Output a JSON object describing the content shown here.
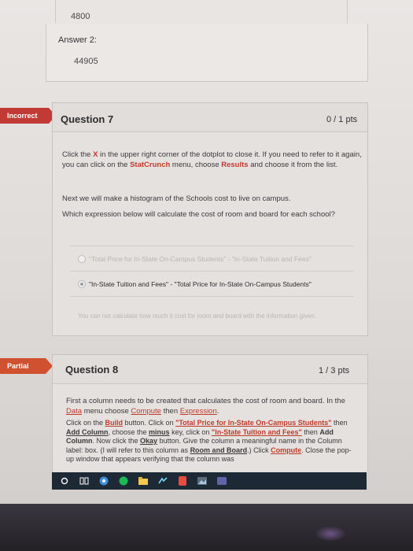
{
  "previous_question": {
    "top_value": "4800",
    "answer_label": "Answer 2:",
    "answer_value": "44905"
  },
  "question7": {
    "flag": "Incorrect",
    "title": "Question 7",
    "points": "0 / 1 pts",
    "instruction": {
      "p1": "Click the ",
      "x": "X",
      "p2": " in the upper right corner of the dotplot to close it. If you need to refer to it again, you can click on the ",
      "statcrunch": "StatCrunch",
      "p3": " menu, choose ",
      "results": "Results",
      "p4": " and choose it from the list."
    },
    "line2": "Next we will make a histogram of the Schools cost to live on campus.",
    "prompt": "Which expression below will calculate the cost of room and board for each school?",
    "options": [
      "\"Total Price for In-State On-Campus Students\" - \"In-State Tuition and Fees\"",
      "\"In-State Tuition and Fees\" - \"Total Price for In-State On-Campus Students\"",
      "You can not calculate how much it cost for room and board with the information given."
    ],
    "selected_index": 1
  },
  "question8": {
    "flag": "Partial",
    "title": "Question 8",
    "points": "1 / 3 pts",
    "para1": {
      "a": "First a column needs to be created that calculates the cost of room and board. In the ",
      "data": "Data",
      "b": " menu choose ",
      "compute": "Compute",
      "c": " then ",
      "expression": "Expression",
      "d": "."
    },
    "para2": {
      "a": "Click on the ",
      "build": "Build",
      "b": " button. Click on ",
      "total_price": "\"Total Price for In-State On-Campus Students\"",
      "c": " then ",
      "add_column": "Add Column",
      "d": ", choose the ",
      "minus": "minus",
      "e": " key, click on ",
      "in_state": "\"In-State Tuition and Fees\"",
      "f": " then ",
      "add_column2": "Add Column",
      "g": ". Now click the ",
      "okay": "Okay",
      "h": " button. Give the column a meaningful name in the Column label: box. (I will refer to this column as ",
      "room_board": "Room and Board",
      "i": ".) Click ",
      "compute": "Compute",
      "j": ". Close the pop-up window that appears verifying that the column was"
    }
  },
  "taskbar": {
    "icons": [
      "search-icon",
      "task-view-icon",
      "chrome-icon",
      "spotify-icon",
      "file-explorer-icon",
      "tidal-icon",
      "office-icon",
      "photos-icon",
      "teams-icon"
    ]
  },
  "colors": {
    "incorrect_flag": "#c23a35",
    "partial_flag": "#cf5130",
    "link": "#c03a2c"
  }
}
